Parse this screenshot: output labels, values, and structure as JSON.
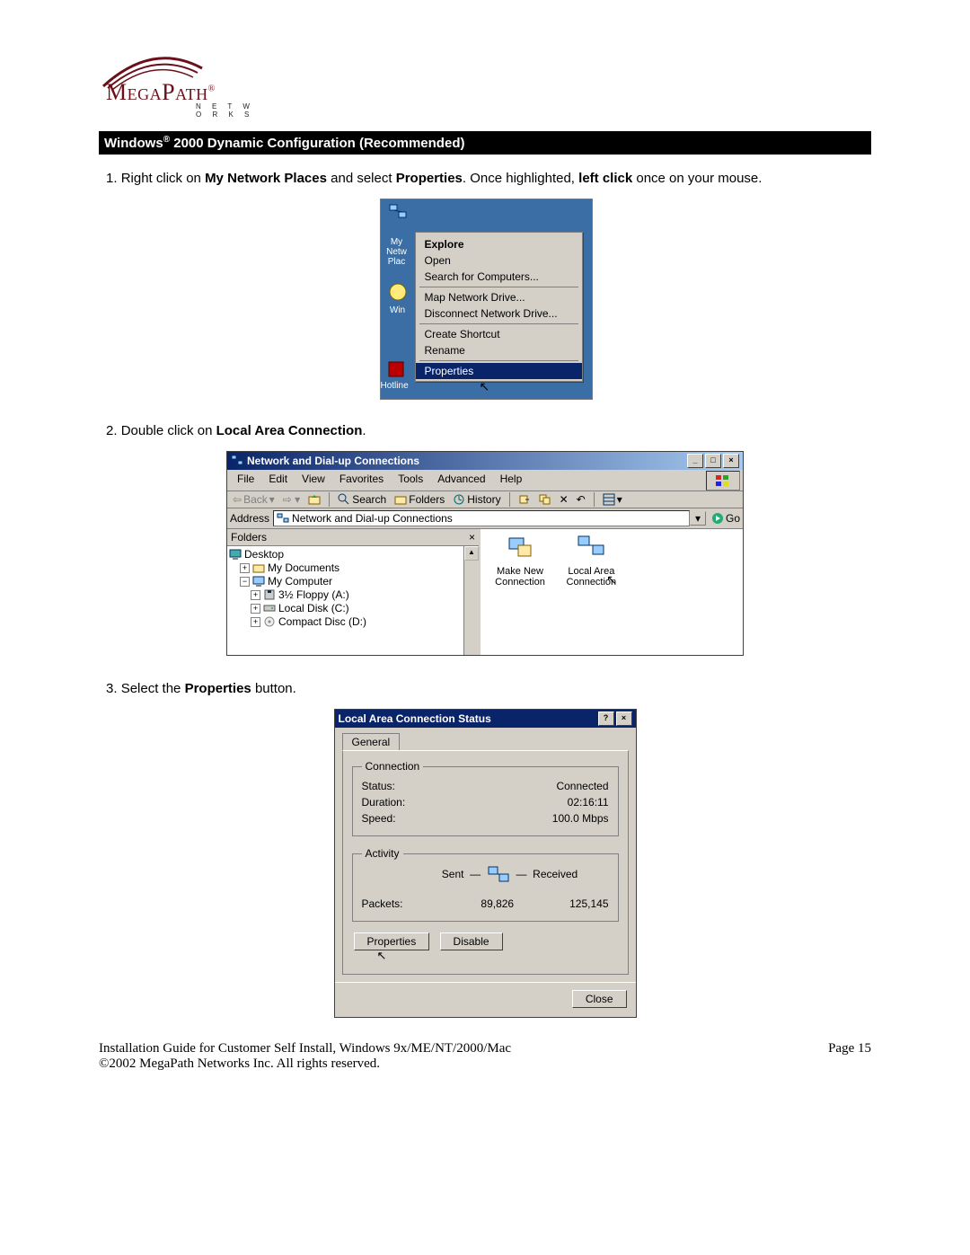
{
  "logo": {
    "brand": "MegaPath",
    "subtitle": "N E T W O R K S"
  },
  "section_title_a": "Windows",
  "section_title_b": " 2000 Dynamic Configuration (Recommended)",
  "step1": {
    "num": "1. ",
    "t1": "Right click on ",
    "b1": "My Network Places",
    "t2": " and select ",
    "b2": "Properties",
    "t3": ". Once highlighted, ",
    "b3": "left click",
    "t4": " once on your mouse."
  },
  "ctx": {
    "desk_labels": {
      "netplaces": "My\nNetw\nPlac",
      "win": "Win",
      "hot": "Hotline"
    },
    "items": {
      "explore": "Explore",
      "open": "Open",
      "search": "Search for Computers...",
      "map": "Map Network Drive...",
      "disc": "Disconnect Network Drive...",
      "shortcut": "Create Shortcut",
      "rename": "Rename",
      "properties": "Properties"
    }
  },
  "step2": {
    "num": "2. ",
    "t1": "Double click on ",
    "b1": "Local Area Connection",
    "t2": "."
  },
  "explorer": {
    "title": "Network and Dial-up Connections",
    "menubar": {
      "file": "File",
      "edit": "Edit",
      "view": "View",
      "fav": "Favorites",
      "tools": "Tools",
      "adv": "Advanced",
      "help": "Help"
    },
    "toolbar": {
      "back": "Back",
      "search": "Search",
      "folders": "Folders",
      "history": "History"
    },
    "address_label": "Address",
    "address_value": "Network and Dial-up Connections",
    "go": "Go",
    "folders_label": "Folders",
    "tree": {
      "desktop": "Desktop",
      "mydocs": "My Documents",
      "mycomp": "My Computer",
      "floppy": "3½ Floppy (A:)",
      "localdisk": "Local Disk (C:)",
      "cd": "Compact Disc (D:)"
    },
    "icons": {
      "makenew_l1": "Make New",
      "makenew_l2": "Connection",
      "lac_l1": "Local Area",
      "lac_l2": "Connection"
    }
  },
  "step3": {
    "num": "3. ",
    "t1": "Select the ",
    "b1": "Properties",
    "t2": " button."
  },
  "dlg": {
    "title": "Local Area Connection Status",
    "tab": "General",
    "grp_conn": "Connection",
    "status_k": "Status:",
    "status_v": "Connected",
    "dur_k": "Duration:",
    "dur_v": "02:16:11",
    "speed_k": "Speed:",
    "speed_v": "100.0 Mbps",
    "grp_act": "Activity",
    "sent": "Sent",
    "recv": "Received",
    "packets_k": "Packets:",
    "packets_sent": "89,826",
    "packets_recv": "125,145",
    "btn_props": "Properties",
    "btn_disable": "Disable",
    "btn_close": "Close"
  },
  "footer": {
    "guide": "Installation Guide for Customer Self Install, Windows 9x/ME/NT/2000/Mac",
    "page": "Page 15",
    "copyright": "©2002 MegaPath Networks Inc. All rights reserved."
  }
}
